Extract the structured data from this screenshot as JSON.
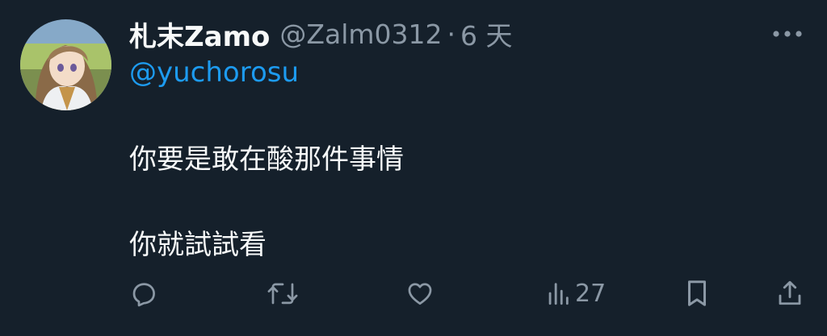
{
  "tweet": {
    "display_name": "札末Zamo",
    "handle": "@Zalm0312",
    "separator": "·",
    "time": "6 天",
    "mention": "@yuchorosu",
    "lines": [
      "你要是敢在酸那件事情",
      "你就試試看"
    ]
  },
  "actions": {
    "views_count": "27"
  },
  "icons": {
    "more": "more-horizontal-icon",
    "reply": "reply-icon",
    "retweet": "retweet-icon",
    "like": "heart-icon",
    "views": "views-bar-chart-icon",
    "bookmark": "bookmark-icon",
    "share": "share-icon"
  },
  "colors": {
    "background": "#15202b",
    "text": "#f7f9f9",
    "secondary": "#8b98a5",
    "accent": "#1d9bf0"
  }
}
